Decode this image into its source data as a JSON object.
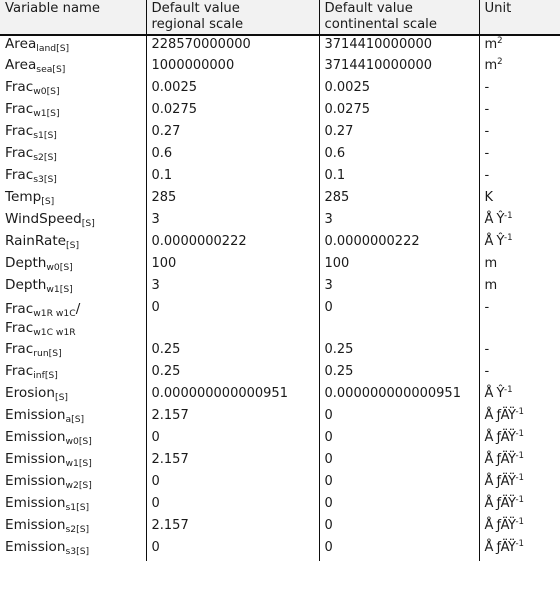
{
  "table": {
    "headers": [
      {
        "line1": "Variable name",
        "line2": ""
      },
      {
        "line1": "Default value",
        "line2": "regional scale"
      },
      {
        "line1": "Default value",
        "line2": "continental scale"
      },
      {
        "line1": "Unit",
        "line2": ""
      }
    ],
    "rows": [
      {
        "base": "Area",
        "sub": "land[S]",
        "regional": "228570000000",
        "continental": "3714410000000",
        "unit_base": "m",
        "unit_sup": "2"
      },
      {
        "base": "Area",
        "sub": "sea[S]",
        "regional": "1000000000",
        "continental": "3714410000000",
        "unit_base": "m",
        "unit_sup": "2"
      },
      {
        "base": "Frac",
        "sub": "w0[S]",
        "regional": "0.0025",
        "continental": "0.0025",
        "unit_base": "-",
        "unit_sup": ""
      },
      {
        "base": "Frac",
        "sub": "w1[S]",
        "regional": "0.0275",
        "continental": "0.0275",
        "unit_base": "-",
        "unit_sup": ""
      },
      {
        "base": "Frac",
        "sub": "s1[S]",
        "regional": "0.27",
        "continental": "0.27",
        "unit_base": "-",
        "unit_sup": ""
      },
      {
        "base": "Frac",
        "sub": "s2[S]",
        "regional": "0.6",
        "continental": "0.6",
        "unit_base": "-",
        "unit_sup": ""
      },
      {
        "base": "Frac",
        "sub": "s3[S]",
        "regional": "0.1",
        "continental": "0.1",
        "unit_base": "-",
        "unit_sup": ""
      },
      {
        "base": "Temp",
        "sub": "[S]",
        "regional": "285",
        "continental": "285",
        "unit_base": "K",
        "unit_sup": ""
      },
      {
        "base": "WindSpeed",
        "sub": "[S]",
        "regional": "3",
        "continental": "3",
        "unit_base": "Å Ŷ",
        "unit_sup": "-1"
      },
      {
        "base": "RainRate",
        "sub": "[S]",
        "regional": "0.0000000222",
        "continental": "0.0000000222",
        "unit_base": "Å Ŷ",
        "unit_sup": "-1"
      },
      {
        "base": "Depth",
        "sub": "w0[S]",
        "regional": "100",
        "continental": "100",
        "unit_base": "m",
        "unit_sup": ""
      },
      {
        "base": "Depth",
        "sub": "w1[S]",
        "regional": "3",
        "continental": "3",
        "unit_base": "m",
        "unit_sup": ""
      },
      {
        "base": "Frac",
        "sub": "w1R  w1C",
        "base2": "Frac",
        "sub2": "w1C  w1R",
        "slash": "/",
        "regional": "0",
        "continental": "0",
        "unit_base": "-",
        "unit_sup": "",
        "tall": true
      },
      {
        "base": "Frac",
        "sub": "run[S]",
        "regional": "0.25",
        "continental": "0.25",
        "unit_base": "-",
        "unit_sup": ""
      },
      {
        "base": "Frac",
        "sub": "inf[S]",
        "regional": "0.25",
        "continental": "0.25",
        "unit_base": "-",
        "unit_sup": ""
      },
      {
        "base": "Erosion",
        "sub": "[S]",
        "regional": "0.000000000000951",
        "continental": "0.000000000000951",
        "unit_base": "Å Ŷ",
        "unit_sup": "-1"
      },
      {
        "base": "Emission",
        "sub": "a[S]",
        "regional": "2.157",
        "continental": "0",
        "unit_base": "Å ƒÄŸ",
        "unit_sup": "-1"
      },
      {
        "base": "Emission",
        "sub": "w0[S]",
        "regional": "0",
        "continental": "0",
        "unit_base": "Å ƒÄŸ",
        "unit_sup": "-1"
      },
      {
        "base": "Emission",
        "sub": "w1[S]",
        "regional": "2.157",
        "continental": "0",
        "unit_base": "Å ƒÄŸ",
        "unit_sup": "-1"
      },
      {
        "base": "Emission",
        "sub": "w2[S]",
        "regional": "0",
        "continental": "0",
        "unit_base": "Å ƒÄŸ",
        "unit_sup": "-1"
      },
      {
        "base": "Emission",
        "sub": "s1[S]",
        "regional": "0",
        "continental": "0",
        "unit_base": "Å ƒÄŸ",
        "unit_sup": "-1"
      },
      {
        "base": "Emission",
        "sub": "s2[S]",
        "regional": "2.157",
        "continental": "0",
        "unit_base": "Å ƒÄŸ",
        "unit_sup": "-1"
      },
      {
        "base": "Emission",
        "sub": "s3[S]",
        "regional": "0",
        "continental": "0",
        "unit_base": "Å ƒÄŸ",
        "unit_sup": "-1"
      }
    ]
  },
  "style": {
    "header_bg": "#f2f2f2",
    "border_color": "#0d0d0d",
    "text_color": "#1a1a1a"
  }
}
